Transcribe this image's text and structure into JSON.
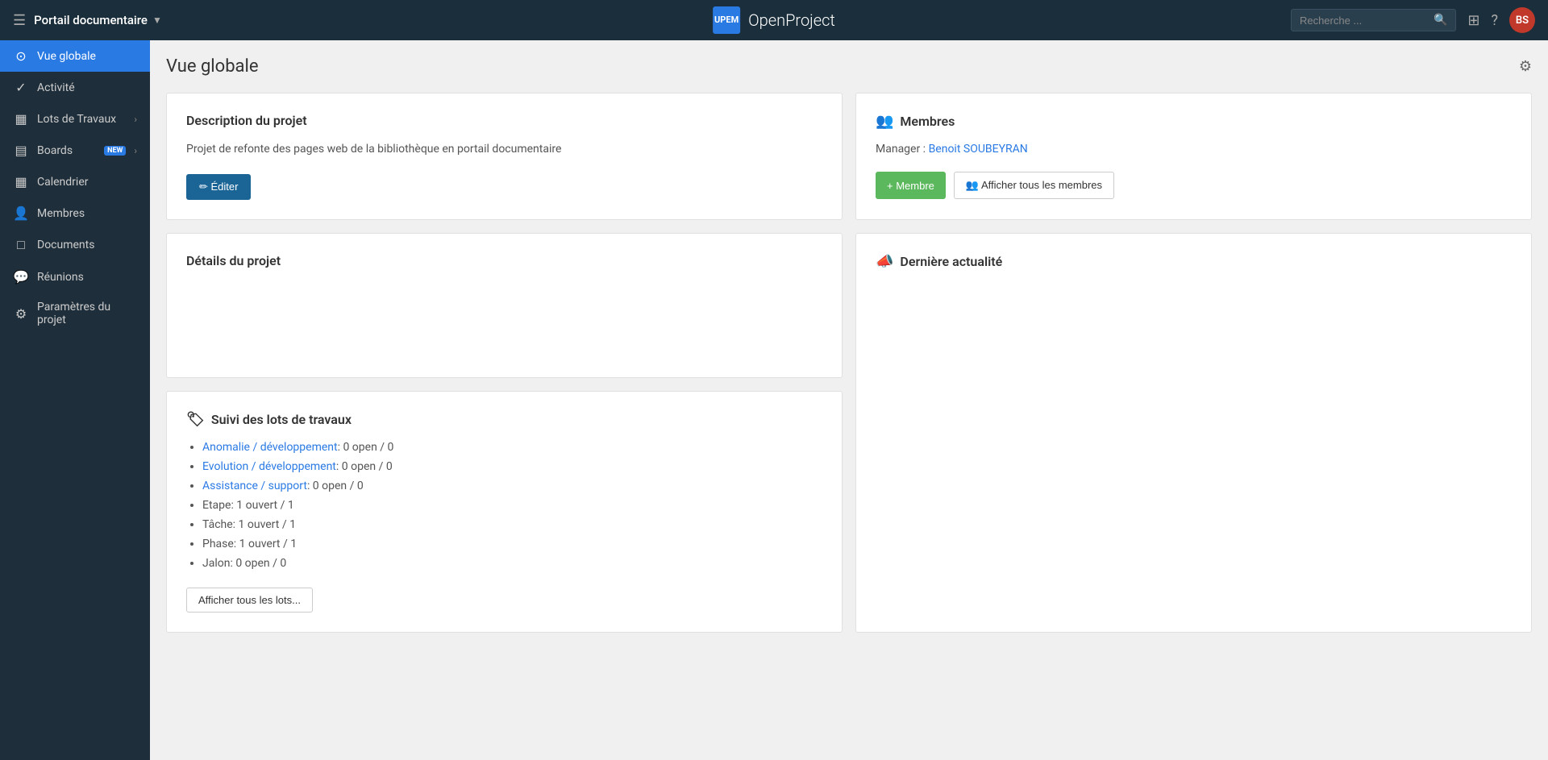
{
  "header": {
    "hamburger_label": "☰",
    "project_name": "Portail documentaire",
    "project_chevron": "▼",
    "logo_line1": "UP",
    "logo_line2": "EM",
    "app_name": "OpenProject",
    "search_placeholder": "Recherche ...",
    "search_icon": "🔍",
    "grid_icon": "⊞",
    "help_icon": "?",
    "user_initials": "BS"
  },
  "sidebar": {
    "items": [
      {
        "id": "vue-globale",
        "icon": "⊙",
        "label": "Vue globale",
        "active": true,
        "arrow": false
      },
      {
        "id": "activite",
        "icon": "✓",
        "label": "Activité",
        "active": false,
        "arrow": false
      },
      {
        "id": "lots-de-travaux",
        "icon": "▦",
        "label": "Lots de Travaux",
        "active": false,
        "arrow": true
      },
      {
        "id": "boards",
        "icon": "▤",
        "label": "Boards",
        "badge": "NEW",
        "active": false,
        "arrow": true
      },
      {
        "id": "calendrier",
        "icon": "📅",
        "label": "Calendrier",
        "active": false,
        "arrow": false
      },
      {
        "id": "membres",
        "icon": "👤",
        "label": "Membres",
        "active": false,
        "arrow": false
      },
      {
        "id": "documents",
        "icon": "□",
        "label": "Documents",
        "active": false,
        "arrow": false
      },
      {
        "id": "reunions",
        "icon": "💬",
        "label": "Réunions",
        "active": false,
        "arrow": false
      },
      {
        "id": "parametres",
        "icon": "⚙",
        "label": "Paramètres du projet",
        "active": false,
        "arrow": false
      }
    ]
  },
  "main": {
    "title": "Vue globale",
    "settings_icon": "⚙",
    "description_card": {
      "title": "Description du projet",
      "icon": "",
      "text": "Projet de refonte des pages web de la bibliothèque en portail documentaire",
      "edit_label": "✏ Éditer"
    },
    "membres_card": {
      "title": "Membres",
      "icon": "👥",
      "manager_prefix": "Manager : ",
      "manager_name": "Benoit SOUBEYRAN",
      "add_label": "+ Membre",
      "view_label": "👥 Afficher tous les membres"
    },
    "details_card": {
      "title": "Détails du projet",
      "icon": ""
    },
    "derniere_card": {
      "title": "Dernière actualité",
      "icon": "📣"
    },
    "suivi_card": {
      "title": "Suivi des lots de travaux",
      "icon": "🏷",
      "items": [
        {
          "link": "Anomalie / développement",
          "text": ": 0 open / 0"
        },
        {
          "link": "Evolution / développement",
          "text": ": 0 open / 0"
        },
        {
          "link": "Assistance / support",
          "text": ": 0 open / 0"
        },
        {
          "link": null,
          "text": "Etape: 1 ouvert / 1"
        },
        {
          "link": null,
          "text": "Tâche: 1 ouvert / 1"
        },
        {
          "link": null,
          "text": "Phase: 1 ouvert / 1"
        },
        {
          "link": null,
          "text": "Jalon: 0 open / 0"
        }
      ],
      "show_all_label": "Afficher tous les lots..."
    }
  }
}
